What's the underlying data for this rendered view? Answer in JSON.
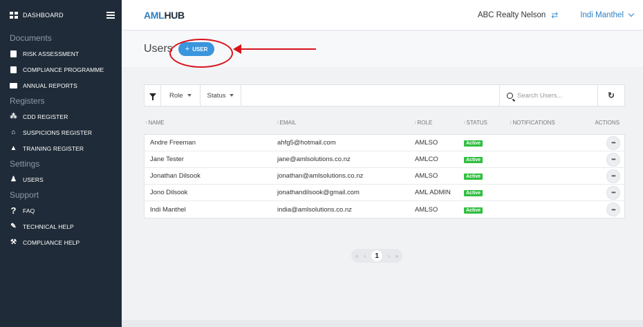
{
  "sidebar": {
    "dashboard_label": "DASHBOARD",
    "sections": {
      "documents": "Documents",
      "registers": "Registers",
      "settings": "Settings",
      "support": "Support"
    },
    "items": {
      "risk_assessment": "RISK ASSESSMENT",
      "compliance_programme": "COMPLIANCE PROGRAMME",
      "annual_reports": "ANNUAL REPORTS",
      "cdd_register": "CDD REGISTER",
      "suspicions_register": "SUSPICIONS REGISTER",
      "training_register": "TRAINING REGISTER",
      "users": "USERS",
      "faq": "FAQ",
      "technical_help": "TECHNICAL HELP",
      "compliance_help": "COMPLIANCE HELP"
    }
  },
  "header": {
    "logo_aml": "AML",
    "logo_hub": "HUB",
    "org_name": "ABC Realty Nelson",
    "user_name": "Indi Manthel"
  },
  "page": {
    "title": "Users",
    "add_button_label": "USER",
    "add_button_plus": "+"
  },
  "filters": {
    "role_label": "Role",
    "status_label": "Status",
    "search_placeholder": "Search Users..."
  },
  "table": {
    "columns": {
      "name": "NAME",
      "email": "EMAIL",
      "role": "ROLE",
      "status": "STATUS",
      "notifications": "NOTIFICATIONS",
      "actions": "ACTIONS"
    },
    "rows": [
      {
        "name": "Andre Freeman",
        "email": "ahfg5@hotmail.com",
        "role": "AMLSO",
        "status": "Active"
      },
      {
        "name": "Jane Tester",
        "email": "jane@amlsolutions.co.nz",
        "role": "AMLCO",
        "status": "Active"
      },
      {
        "name": "Jonathan Dilsook",
        "email": "jonathan@amlsolutions.co.nz",
        "role": "AMLSO",
        "status": "Active"
      },
      {
        "name": "Jono Dilsook",
        "email": "jonathandilsook@gmail.com",
        "role": "AML ADMIN",
        "status": "Active"
      },
      {
        "name": "Indi Manthel",
        "email": "india@amlsolutions.co.nz",
        "role": "AMLSO",
        "status": "Active"
      }
    ],
    "actions_glyph": "•••"
  },
  "pagination": {
    "first": "«",
    "prev": "‹",
    "current": "1",
    "next": "›",
    "last": "»"
  },
  "colors": {
    "sidebar_bg": "#1f2b38",
    "accent": "#3a95dd",
    "active_badge": "#2fbf3f",
    "annotation": "#d9121b"
  }
}
